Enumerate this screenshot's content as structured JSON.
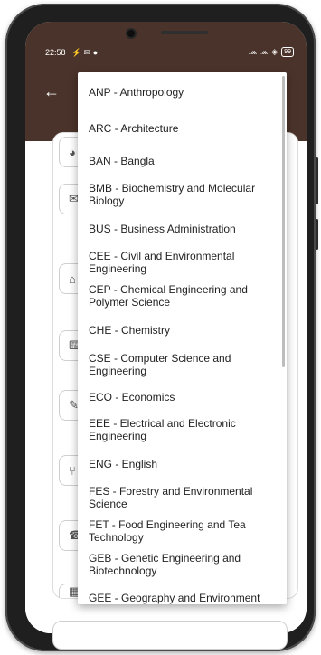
{
  "status_bar": {
    "time": "22:58",
    "notification_icons": "⚡ ✉ ●",
    "signal": ".⩕ .⩕",
    "battery": "99"
  },
  "colors": {
    "appbar": "#4a332a",
    "dropdown_bg": "#ffffff",
    "text": "#222222"
  },
  "department_options": [
    "ANP - Anthropology",
    "ARC - Architecture",
    "BAN - Bangla",
    "BMB - Biochemistry and Molecular Biology",
    "BUS - Business Administration",
    "CEE - Civil and Environmental Engineering",
    "CEP - Chemical Engineering and Polymer Science",
    "CHE - Chemistry",
    "CSE - Computer Science and Engineering",
    "ECO - Economics",
    "EEE - Electrical and Electronic Engineering",
    "ENG - English",
    "FES - Forestry and Environmental Science",
    "FET - Food Engineering and Tea Technology",
    "GEB - Genetic Engineering and Biotechnology",
    "GEE - Geography and Environment"
  ],
  "icons": {
    "back": "←",
    "person": "◕",
    "mail": "✉",
    "home": "⌂",
    "keyboard": "⌨",
    "pencil": "✎",
    "fork": "⑂",
    "phone": "☎",
    "building": "▦"
  }
}
